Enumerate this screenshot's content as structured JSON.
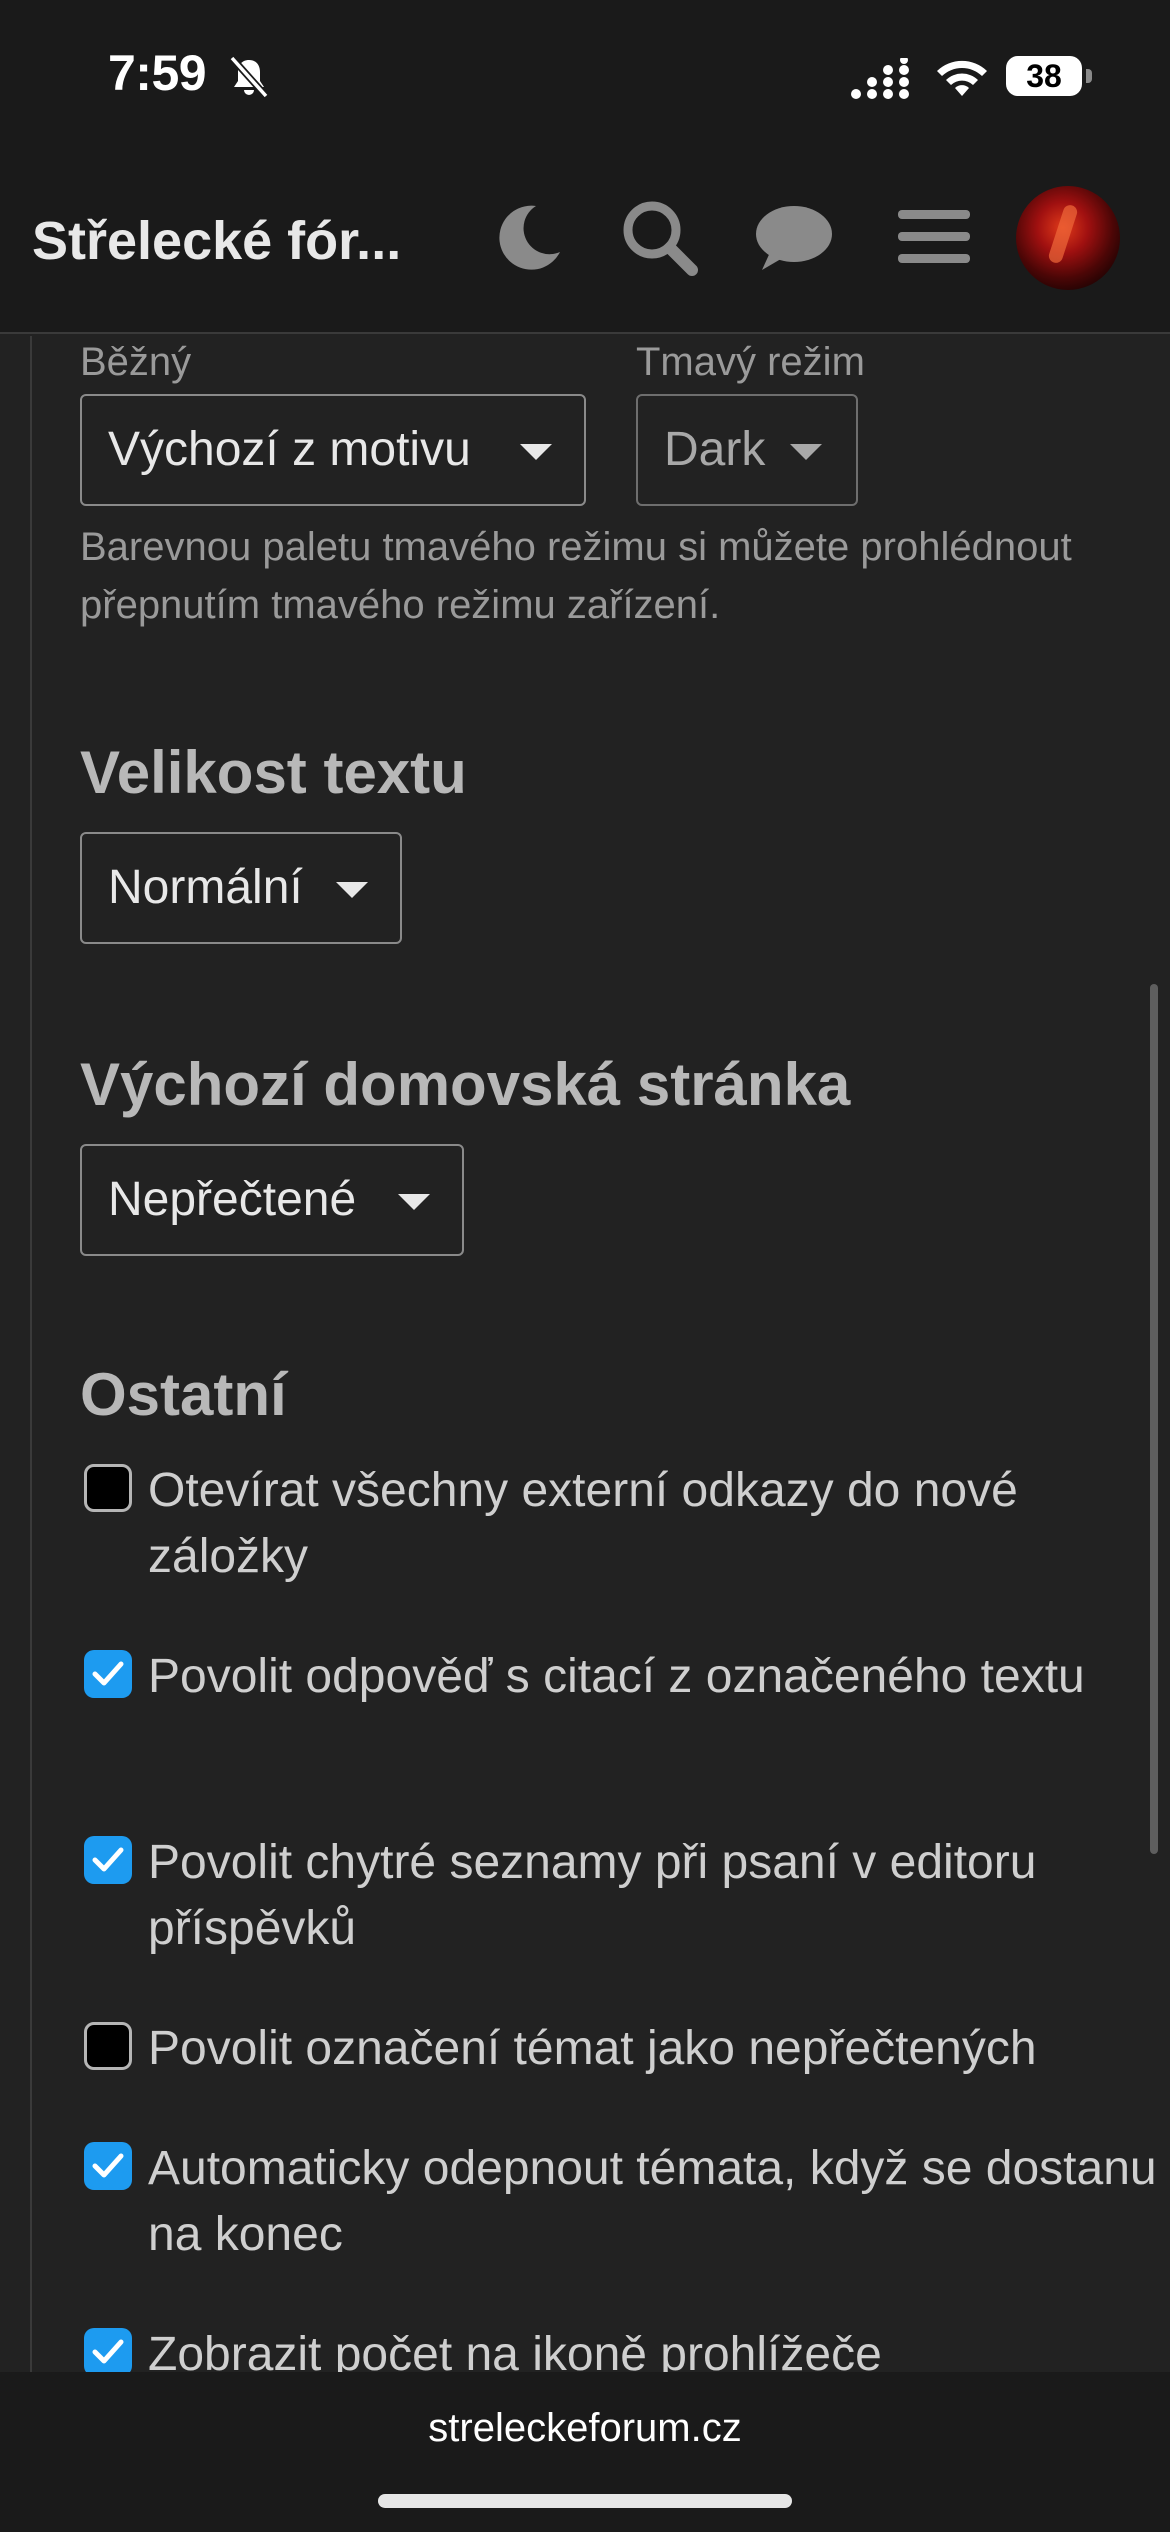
{
  "status_bar": {
    "time": "7:59",
    "battery_percent": "38",
    "silent_mode": true
  },
  "header": {
    "site_title": "Střelecké fór...",
    "icons": [
      "moon-icon",
      "search-icon",
      "chat-icon",
      "hamburger-menu-icon",
      "avatar"
    ]
  },
  "theme": {
    "regular_label": "Běžný",
    "regular_value": "Výchozí z motivu",
    "dark_label": "Tmavý režim",
    "dark_value": "Dark",
    "help": "Barevnou paletu tmavého režimu si můžete prohlédnout přepnutím tmavého režimu zařízení."
  },
  "text_size": {
    "heading": "Velikost textu",
    "value": "Normální"
  },
  "homepage": {
    "heading": "Výchozí domovská stránka",
    "value": "Nepřečtené"
  },
  "other": {
    "heading": "Ostatní",
    "options": [
      {
        "label": "Otevírat všechny externí odkazy do nové záložky",
        "checked": false
      },
      {
        "label": "Povolit odpověď s citací z označeného textu",
        "checked": true
      },
      {
        "label": "Povolit chytré seznamy při psaní v editoru příspěvků",
        "checked": true
      },
      {
        "label": "Povolit označení témat jako nepřečtených",
        "checked": false
      },
      {
        "label": "Automaticky odepnout témata, když se dostanu na konec",
        "checked": true
      },
      {
        "label": "Zobrazit počet na ikoně prohlížeče",
        "checked": true
      }
    ]
  },
  "browser": {
    "url": "streleckeforum.cz"
  },
  "colors": {
    "accent": "#1d9bf0",
    "background": "#222222",
    "header": "#1a1a1a"
  }
}
